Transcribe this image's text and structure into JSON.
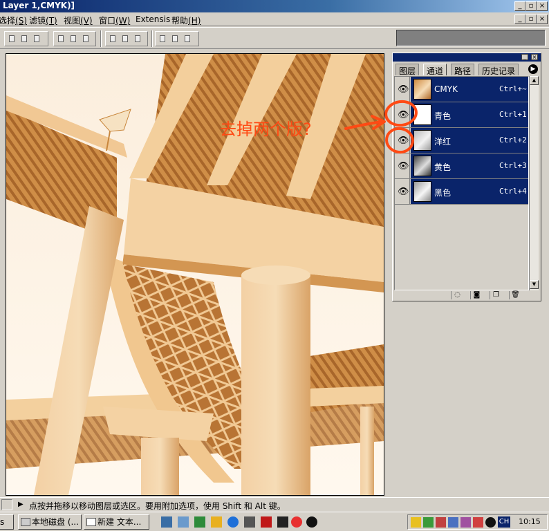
{
  "window": {
    "title": "Layer 1,CMYK)]",
    "controls": [
      "_",
      "▫",
      "×"
    ]
  },
  "menu": [
    {
      "label": "选择",
      "key": "(S)"
    },
    {
      "label": "滤镜",
      "key": "(T)"
    },
    {
      "label": "视图",
      "key": "(V)"
    },
    {
      "label": "窗口",
      "key": "(W)"
    },
    {
      "label": "Extensis",
      "key": ""
    },
    {
      "label": "帮助",
      "key": "(H)"
    }
  ],
  "palette": {
    "tabs": [
      "图层",
      "通道",
      "路径",
      "历史记录"
    ],
    "active_tab": "通道",
    "channels": [
      {
        "name": "CMYK",
        "shortcut": "Ctrl+~"
      },
      {
        "name": "青色",
        "shortcut": "Ctrl+1"
      },
      {
        "name": "洋红",
        "shortcut": "Ctrl+2"
      },
      {
        "name": "黄色",
        "shortcut": "Ctrl+3"
      },
      {
        "name": "黑色",
        "shortcut": "Ctrl+4"
      }
    ]
  },
  "annotation": {
    "text": "去掉两个版?",
    "color": "#ff4a14"
  },
  "status": {
    "text": "点按并拖移以移动图层或选区。要用附加选项，使用 Shift 和 Alt 键。"
  },
  "taskbar": {
    "buttons": [
      "s",
      "本地磁盘 (...",
      "新建 文本..."
    ],
    "input_indicator": "CH",
    "clock": "10:15"
  },
  "colors": {
    "selection": "#0a246a",
    "sepia_dark": "#c8863c",
    "sepia_light": "#f6dcb6",
    "annotation": "#ff4a14"
  }
}
